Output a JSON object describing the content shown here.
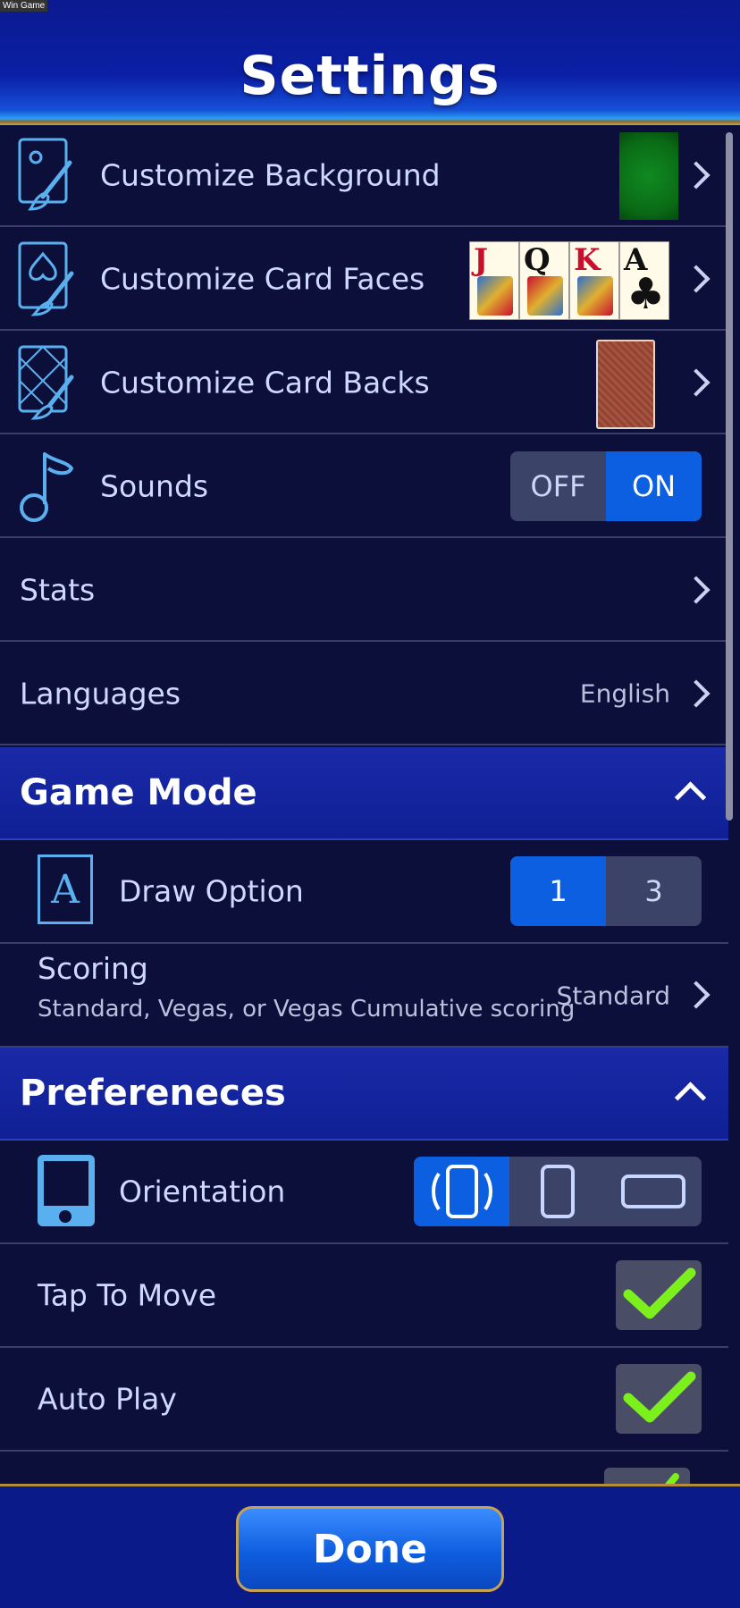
{
  "window_label": "Win Game",
  "header": {
    "title": "Settings"
  },
  "rows": {
    "customize_background": {
      "label": "Customize Background",
      "preview_color": "#0a6a15"
    },
    "customize_card_faces": {
      "label": "Customize Card Faces",
      "cards": [
        "J",
        "Q",
        "K",
        "A"
      ]
    },
    "customize_card_backs": {
      "label": "Customize Card Backs",
      "preview_color": "#a8523e"
    },
    "sounds": {
      "label": "Sounds",
      "off_label": "OFF",
      "on_label": "ON",
      "selected": "ON"
    },
    "stats": {
      "label": "Stats"
    },
    "languages": {
      "label": "Languages",
      "value": "English"
    }
  },
  "game_mode": {
    "title": "Game Mode",
    "draw_option": {
      "label": "Draw Option",
      "options": [
        "1",
        "3"
      ],
      "selected": "1"
    },
    "scoring": {
      "label": "Scoring",
      "description": "Standard, Vegas, or Vegas Cumulative scoring",
      "value": "Standard"
    }
  },
  "preferences": {
    "title": "Prefereneces",
    "orientation": {
      "label": "Orientation",
      "selected": "auto-rotate"
    },
    "tap_to_move": {
      "label": "Tap To Move",
      "checked": true
    },
    "auto_play": {
      "label": "Auto Play",
      "checked": true
    }
  },
  "footer": {
    "done_label": "Done"
  },
  "colors": {
    "accent_blue": "#0b5fe0",
    "check_green": "#7cf01a",
    "icon_blue": "#5ab0ee",
    "gold_border": "#c9a24f"
  }
}
